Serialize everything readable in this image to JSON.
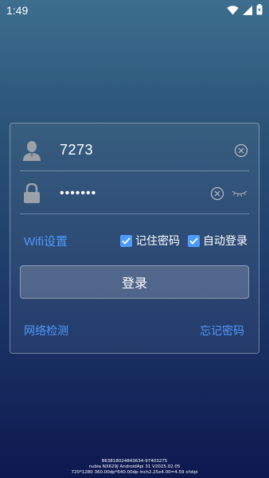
{
  "status_bar": {
    "time": "1:49"
  },
  "login": {
    "username": "7273",
    "password_masked": "•••••••",
    "wifi_settings": "Wifi设置",
    "remember_password": "记住密码",
    "auto_login": "自动登录",
    "login_button": "登录",
    "network_check": "网络检测",
    "forgot_password": "忘记密码"
  },
  "device_info": {
    "line1": "863818024843634-97403275",
    "line2": "nubia  NX629J  AndroidApi 31 V2025.02.05",
    "line3": "720*1280  360.00dp*640.00dp  inch2.25x4.00=4.59 xhdpi"
  },
  "colors": {
    "accent": "#4d9bff"
  }
}
